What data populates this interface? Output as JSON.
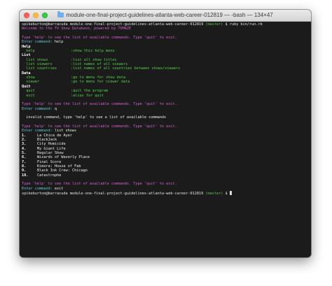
{
  "window": {
    "title": "module-one-final-project-guidelines-atlanta-web-career-012819 — -bash — 134×47"
  },
  "terminal": {
    "prompt_user": "spikeburton@barracuda module-one-final-project-guidelines-atlanta-web-career-012819",
    "prompt_branch": "(master)",
    "prompt_symbol": "$",
    "run_command": "ruby bin/run.rb",
    "welcome": "Welcome to the TV Show Database, powered by TVMAZE",
    "hint": "Type 'help' to see the list of available commands. Type 'quit' to exit.",
    "enter_prompt": "Enter command:",
    "cmd_help": "help",
    "cmd_q": "q",
    "cmd_list_shows": "list shows",
    "cmd_exit": "exit",
    "invalid_msg": "invalid command, type 'help' to see a list of available commands",
    "help_sections": [
      {
        "heading": "Help",
        "rows": [
          {
            "cmd": "help",
            "desc": ":show this help menu"
          }
        ]
      },
      {
        "heading": "List",
        "rows": [
          {
            "cmd": "list shows",
            "desc": ":list all show titles"
          },
          {
            "cmd": "list viewers",
            "desc": ":list names of all viewers"
          },
          {
            "cmd": "list countries",
            "desc": ":list names of all countries between shows/viewers"
          }
        ]
      },
      {
        "heading": "Data",
        "rows": [
          {
            "cmd": "show",
            "desc": ":go to menu for show data"
          },
          {
            "cmd": "viewer",
            "desc": ":go to menu for viewer data"
          }
        ]
      },
      {
        "heading": "Quit",
        "rows": [
          {
            "cmd": "quit",
            "desc": ":quit the program"
          },
          {
            "cmd": "exit",
            "desc": ":alias for quit"
          }
        ]
      }
    ],
    "shows": [
      {
        "num": "1.",
        "title": "La Chica de Ayer"
      },
      {
        "num": "2.",
        "title": "BlackJack"
      },
      {
        "num": "3.",
        "title": "City Homicide"
      },
      {
        "num": "4.",
        "title": "My Giant Life"
      },
      {
        "num": "5.",
        "title": "Regular Show"
      },
      {
        "num": "6.",
        "title": "Wizards of Waverly Place"
      },
      {
        "num": "7.",
        "title": "Final Score"
      },
      {
        "num": "8.",
        "title": "Kimora: House of Fab"
      },
      {
        "num": "9.",
        "title": "Black Ink Crew: Chicago"
      },
      {
        "num": "10.",
        "title": "Catastrophe"
      }
    ]
  },
  "colors": {
    "background": "#1b1b1b",
    "text": "#e6e6e6",
    "branch": "#57c84a",
    "magenta": "#d45fd2",
    "cyan": "#5ac7d6",
    "green": "#55d14b"
  }
}
